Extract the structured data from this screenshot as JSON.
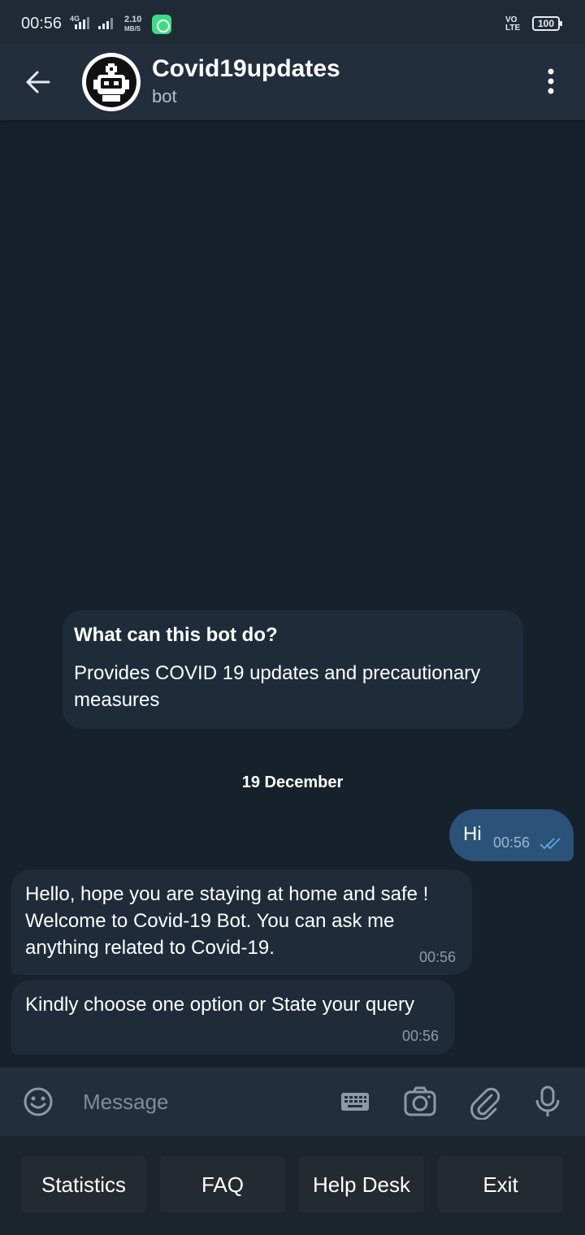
{
  "status_bar": {
    "time": "00:56",
    "network": "4G",
    "speed_value": "2.10",
    "speed_unit": "MB/S",
    "volte_top": "VO",
    "volte_bottom": "LTE",
    "battery": "100"
  },
  "header": {
    "title": "Covid19updates",
    "subtitle": "bot"
  },
  "bot_info": {
    "title": "What can this bot do?",
    "description": "Provides COVID 19 updates and precautionary measures"
  },
  "date_separator": "19 December",
  "messages": [
    {
      "direction": "outgoing",
      "text": "Hi",
      "time": "00:56",
      "status": "read"
    },
    {
      "direction": "incoming",
      "text": "Hello, hope you are staying at home and safe ! Welcome to Covid-19 Bot. You can ask me anything related to Covid-19.",
      "time": "00:56"
    },
    {
      "direction": "incoming",
      "text": "Kindly choose one option or State your query",
      "time": "00:56"
    }
  ],
  "input": {
    "placeholder": "Message",
    "value": ""
  },
  "keyboard_buttons": [
    "Statistics",
    "FAQ",
    "Help Desk",
    "Exit"
  ],
  "colors": {
    "background": "#17212b",
    "header": "#232e3c",
    "outgoing_bubble": "#2b5278",
    "incoming_bubble": "#1f2b39",
    "read_ticks": "#5ea7e8"
  }
}
